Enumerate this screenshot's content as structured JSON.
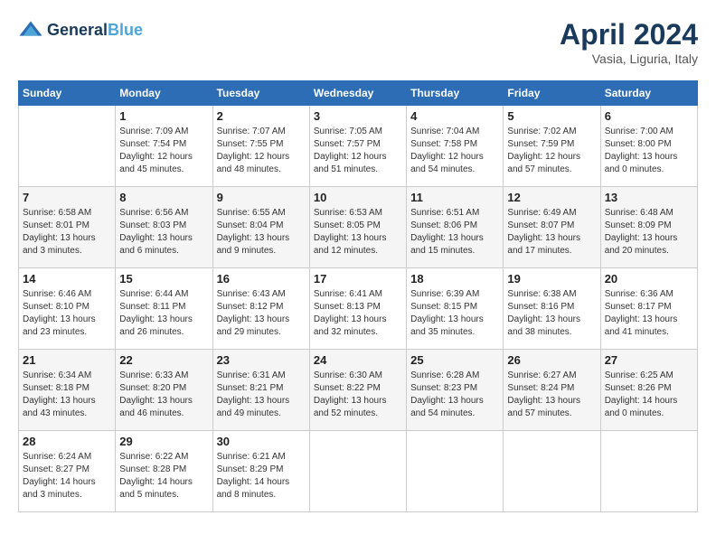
{
  "header": {
    "logo_line1": "General",
    "logo_line2": "Blue",
    "month": "April 2024",
    "location": "Vasia, Liguria, Italy"
  },
  "weekdays": [
    "Sunday",
    "Monday",
    "Tuesday",
    "Wednesday",
    "Thursday",
    "Friday",
    "Saturday"
  ],
  "weeks": [
    [
      {
        "day": "",
        "info": ""
      },
      {
        "day": "1",
        "info": "Sunrise: 7:09 AM\nSunset: 7:54 PM\nDaylight: 12 hours\nand 45 minutes."
      },
      {
        "day": "2",
        "info": "Sunrise: 7:07 AM\nSunset: 7:55 PM\nDaylight: 12 hours\nand 48 minutes."
      },
      {
        "day": "3",
        "info": "Sunrise: 7:05 AM\nSunset: 7:57 PM\nDaylight: 12 hours\nand 51 minutes."
      },
      {
        "day": "4",
        "info": "Sunrise: 7:04 AM\nSunset: 7:58 PM\nDaylight: 12 hours\nand 54 minutes."
      },
      {
        "day": "5",
        "info": "Sunrise: 7:02 AM\nSunset: 7:59 PM\nDaylight: 12 hours\nand 57 minutes."
      },
      {
        "day": "6",
        "info": "Sunrise: 7:00 AM\nSunset: 8:00 PM\nDaylight: 13 hours\nand 0 minutes."
      }
    ],
    [
      {
        "day": "7",
        "info": "Sunrise: 6:58 AM\nSunset: 8:01 PM\nDaylight: 13 hours\nand 3 minutes."
      },
      {
        "day": "8",
        "info": "Sunrise: 6:56 AM\nSunset: 8:03 PM\nDaylight: 13 hours\nand 6 minutes."
      },
      {
        "day": "9",
        "info": "Sunrise: 6:55 AM\nSunset: 8:04 PM\nDaylight: 13 hours\nand 9 minutes."
      },
      {
        "day": "10",
        "info": "Sunrise: 6:53 AM\nSunset: 8:05 PM\nDaylight: 13 hours\nand 12 minutes."
      },
      {
        "day": "11",
        "info": "Sunrise: 6:51 AM\nSunset: 8:06 PM\nDaylight: 13 hours\nand 15 minutes."
      },
      {
        "day": "12",
        "info": "Sunrise: 6:49 AM\nSunset: 8:07 PM\nDaylight: 13 hours\nand 17 minutes."
      },
      {
        "day": "13",
        "info": "Sunrise: 6:48 AM\nSunset: 8:09 PM\nDaylight: 13 hours\nand 20 minutes."
      }
    ],
    [
      {
        "day": "14",
        "info": "Sunrise: 6:46 AM\nSunset: 8:10 PM\nDaylight: 13 hours\nand 23 minutes."
      },
      {
        "day": "15",
        "info": "Sunrise: 6:44 AM\nSunset: 8:11 PM\nDaylight: 13 hours\nand 26 minutes."
      },
      {
        "day": "16",
        "info": "Sunrise: 6:43 AM\nSunset: 8:12 PM\nDaylight: 13 hours\nand 29 minutes."
      },
      {
        "day": "17",
        "info": "Sunrise: 6:41 AM\nSunset: 8:13 PM\nDaylight: 13 hours\nand 32 minutes."
      },
      {
        "day": "18",
        "info": "Sunrise: 6:39 AM\nSunset: 8:15 PM\nDaylight: 13 hours\nand 35 minutes."
      },
      {
        "day": "19",
        "info": "Sunrise: 6:38 AM\nSunset: 8:16 PM\nDaylight: 13 hours\nand 38 minutes."
      },
      {
        "day": "20",
        "info": "Sunrise: 6:36 AM\nSunset: 8:17 PM\nDaylight: 13 hours\nand 41 minutes."
      }
    ],
    [
      {
        "day": "21",
        "info": "Sunrise: 6:34 AM\nSunset: 8:18 PM\nDaylight: 13 hours\nand 43 minutes."
      },
      {
        "day": "22",
        "info": "Sunrise: 6:33 AM\nSunset: 8:20 PM\nDaylight: 13 hours\nand 46 minutes."
      },
      {
        "day": "23",
        "info": "Sunrise: 6:31 AM\nSunset: 8:21 PM\nDaylight: 13 hours\nand 49 minutes."
      },
      {
        "day": "24",
        "info": "Sunrise: 6:30 AM\nSunset: 8:22 PM\nDaylight: 13 hours\nand 52 minutes."
      },
      {
        "day": "25",
        "info": "Sunrise: 6:28 AM\nSunset: 8:23 PM\nDaylight: 13 hours\nand 54 minutes."
      },
      {
        "day": "26",
        "info": "Sunrise: 6:27 AM\nSunset: 8:24 PM\nDaylight: 13 hours\nand 57 minutes."
      },
      {
        "day": "27",
        "info": "Sunrise: 6:25 AM\nSunset: 8:26 PM\nDaylight: 14 hours\nand 0 minutes."
      }
    ],
    [
      {
        "day": "28",
        "info": "Sunrise: 6:24 AM\nSunset: 8:27 PM\nDaylight: 14 hours\nand 3 minutes."
      },
      {
        "day": "29",
        "info": "Sunrise: 6:22 AM\nSunset: 8:28 PM\nDaylight: 14 hours\nand 5 minutes."
      },
      {
        "day": "30",
        "info": "Sunrise: 6:21 AM\nSunset: 8:29 PM\nDaylight: 14 hours\nand 8 minutes."
      },
      {
        "day": "",
        "info": ""
      },
      {
        "day": "",
        "info": ""
      },
      {
        "day": "",
        "info": ""
      },
      {
        "day": "",
        "info": ""
      }
    ]
  ]
}
